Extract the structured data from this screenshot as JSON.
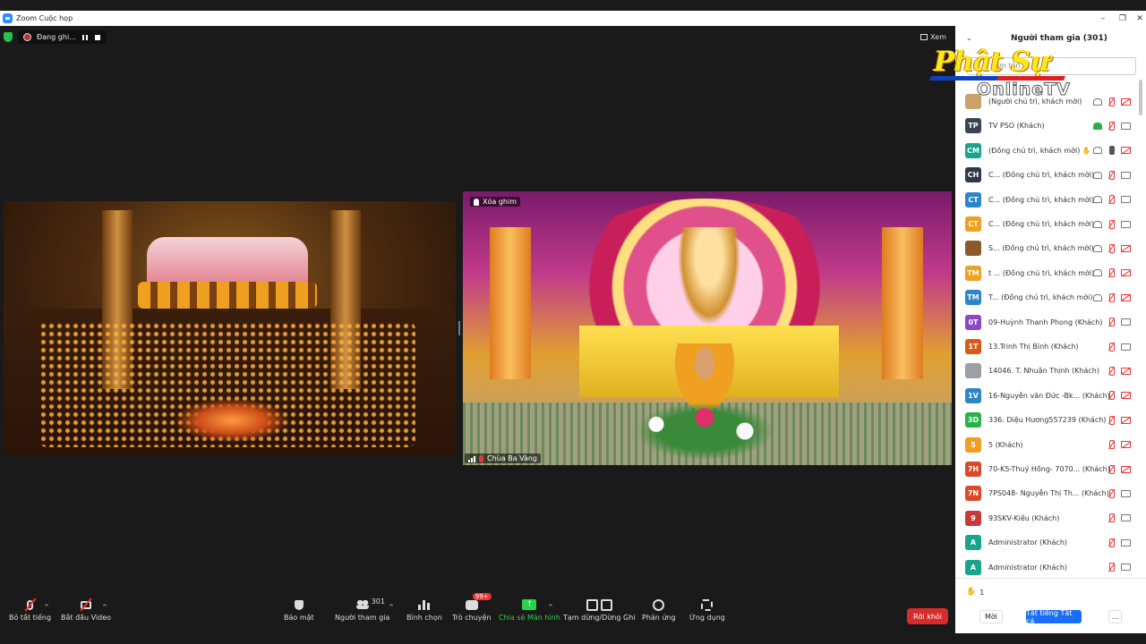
{
  "window": {
    "title": "Zoom Cuộc họp",
    "controls": [
      "–",
      "❐",
      "✕"
    ]
  },
  "meeting": {
    "recording_label": "Đang ghi...",
    "view_label": "Xem",
    "pinned_label": "Xóa ghim",
    "pinned_video_name": "Chùa Ba Vàng"
  },
  "toolbar": {
    "mute_label": "Bỏ tắt tiếng",
    "video_label": "Bắt đầu Video",
    "security_label": "Bảo mật",
    "participants_label": "Người tham gia",
    "participants_count": "301",
    "polls_label": "Bình chọn",
    "chat_label": "Trò chuyện",
    "chat_badge": "99+",
    "share_label": "Chia sẻ Màn hình",
    "pause_stop_label": "Tạm dừng/Dừng Ghi",
    "reactions_label": "Phản ứng",
    "apps_label": "Ứng dụng",
    "leave_label": "Rời khỏi"
  },
  "panel": {
    "title": "Người tham gia (301)",
    "search_placeholder": "Tìm tên",
    "logo_main": "Phật Sự",
    "logo_sub": "OnlineTV",
    "raised_hands": "1",
    "invite_label": "Mời",
    "mute_all_label": "Tắt tiếng Tất cả",
    "more_label": "..."
  },
  "participants": [
    {
      "initials": "",
      "color": "#c9a36a",
      "name": "(Người chủ trì, khách mời)",
      "mic": "off",
      "video": "off",
      "extra": "cloud"
    },
    {
      "initials": "TP",
      "color": "#3a4552",
      "name": "TV PSO (Khách)",
      "mic": "off",
      "video": "on",
      "extra": "green"
    },
    {
      "initials": "CM",
      "color": "#19a58a",
      "name": "(Đồng chủ trì, khách mời) ✋",
      "mic": "on",
      "video": "off",
      "extra": "cloud"
    },
    {
      "initials": "CH",
      "color": "#2f3a46",
      "name": "C... (Đồng chủ trì, khách mời)",
      "mic": "off",
      "video": "on",
      "extra": "cloud"
    },
    {
      "initials": "CT",
      "color": "#2d86c8",
      "name": "C... (Đồng chủ trì, khách mời)",
      "mic": "off",
      "video": "on",
      "extra": "cloud"
    },
    {
      "initials": "CT",
      "color": "#f0a020",
      "name": "C... (Đồng chủ trì, khách mời)",
      "mic": "off",
      "video": "on",
      "extra": "cloud"
    },
    {
      "initials": "",
      "color": "#8a5a2a",
      "name": "S... (Đồng chủ trì, khách mời)",
      "mic": "off",
      "video": "off",
      "extra": "cloud"
    },
    {
      "initials": "TM",
      "color": "#f0a020",
      "name": "t ... (Đồng chủ trì, khách mời)",
      "mic": "off",
      "video": "off",
      "extra": "cloud"
    },
    {
      "initials": "TM",
      "color": "#2d86c8",
      "name": "T... (Đồng chủ trì, khách mời)",
      "mic": "off",
      "video": "off",
      "extra": "cloud"
    },
    {
      "initials": "0T",
      "color": "#8a4ac8",
      "name": "09-Huỳnh Thanh Phong (Khách)",
      "mic": "off",
      "video": "on",
      "extra": ""
    },
    {
      "initials": "1T",
      "color": "#d85a1a",
      "name": "13.Trinh Thị Bình (Khách)",
      "mic": "off",
      "video": "on",
      "extra": ""
    },
    {
      "initials": "",
      "color": "#9aa0a6",
      "name": "14046. T. Nhuận Thịnh (Khách)",
      "mic": "off",
      "video": "off",
      "extra": ""
    },
    {
      "initials": "1V",
      "color": "#2d86c8",
      "name": "16-Nguyễn văn Đức -Bk... (Khách)",
      "mic": "off",
      "video": "off",
      "extra": ""
    },
    {
      "initials": "3D",
      "color": "#2ab24a",
      "name": "336. Diệu Hương557239 (Khách)",
      "mic": "off",
      "video": "off",
      "extra": ""
    },
    {
      "initials": "5",
      "color": "#f0a020",
      "name": "5 (Khách)",
      "mic": "off",
      "video": "off",
      "extra": ""
    },
    {
      "initials": "7H",
      "color": "#d84a2a",
      "name": "70-K5-Thuý Hồng- 7070... (Khách)",
      "mic": "off",
      "video": "off",
      "extra": ""
    },
    {
      "initials": "7N",
      "color": "#d84a2a",
      "name": "7PS048- Nguyễn Thị Th... (Khách)",
      "mic": "off",
      "video": "on",
      "extra": ""
    },
    {
      "initials": "9",
      "color": "#c83a3a",
      "name": "93SKV-Kiều (Khách)",
      "mic": "off",
      "video": "on",
      "extra": ""
    },
    {
      "initials": "A",
      "color": "#19a58a",
      "name": "Administrator (Khách)",
      "mic": "off",
      "video": "on",
      "extra": ""
    },
    {
      "initials": "A",
      "color": "#19a58a",
      "name": "Administrator (Khách)",
      "mic": "off",
      "video": "on",
      "extra": ""
    }
  ]
}
